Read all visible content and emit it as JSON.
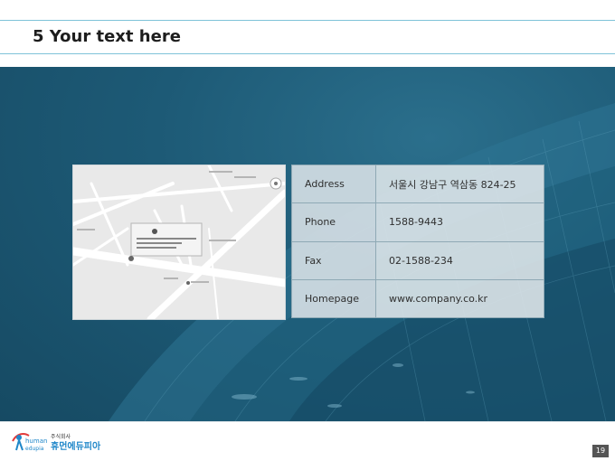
{
  "slide": {
    "title": "5 Your text here",
    "page_number": "19"
  },
  "contact": {
    "rows": [
      {
        "label": "Address",
        "value": "서울시 강남구 역삼동 824-25"
      },
      {
        "label": "Phone",
        "value": "1588-9443"
      },
      {
        "label": "Fax",
        "value": "02-1588-234"
      },
      {
        "label": "Homepage",
        "value": "www.company.co.kr"
      }
    ]
  },
  "logo": {
    "text_line1": "주식회사",
    "text_line2": "휴먼에듀피아",
    "text_en1": "human",
    "text_en2": "edupia"
  },
  "colors": {
    "accent_rule": "#7fc3d8",
    "hero_bg": "#1d5a76",
    "logo_blue": "#1f87c9"
  }
}
